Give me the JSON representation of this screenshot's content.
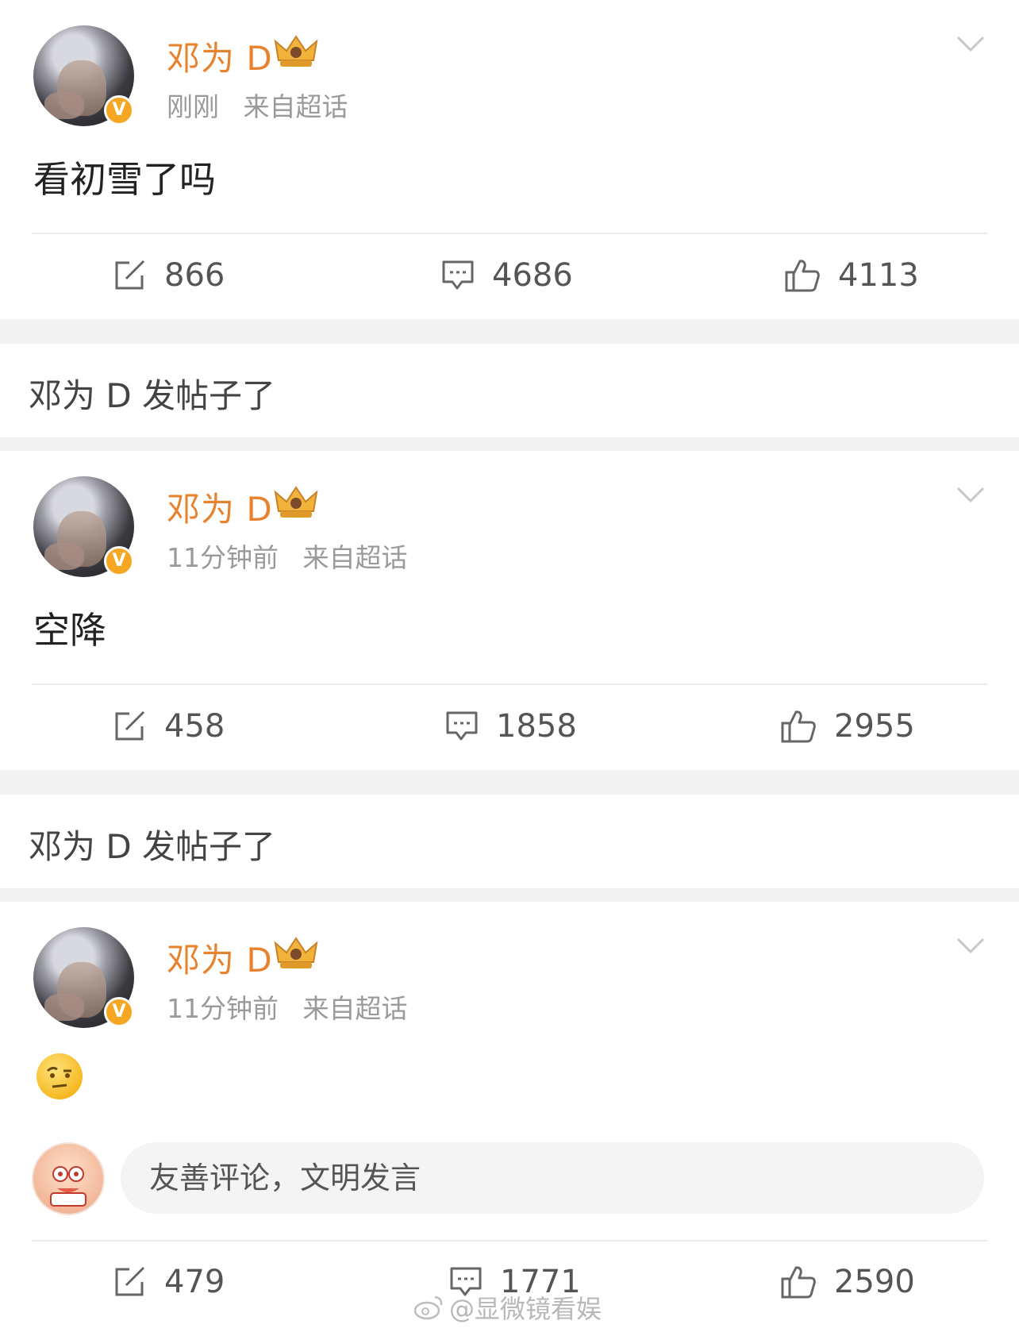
{
  "posts": [
    {
      "username": "邓为 D",
      "time": "刚刚",
      "source": "来自超话",
      "content": "看初雪了吗",
      "reposts": "866",
      "comments": "4686",
      "likes": "4113"
    },
    {
      "username": "邓为 D",
      "time": "11分钟前",
      "source": "来自超话",
      "content": "空降",
      "reposts": "458",
      "comments": "1858",
      "likes": "2955"
    },
    {
      "username": "邓为 D",
      "time": "11分钟前",
      "source": "来自超话",
      "content": "",
      "emoji": "raised-eyebrow-emoji",
      "reposts": "479",
      "comments": "1771",
      "likes": "2590"
    }
  ],
  "section_headers": [
    "邓为 D 发帖子了",
    "邓为 D 发帖子了"
  ],
  "comment_box": {
    "placeholder": "友善评论，文明发言"
  },
  "watermark": "@显微镜看娱",
  "icons": {
    "verified": "verified-v-badge-icon",
    "crown": "crown-badge-icon",
    "more": "chevron-down-icon",
    "repost": "repost-icon",
    "comment": "comment-icon",
    "like": "thumbs-up-icon"
  },
  "colors": {
    "username": "#e8822d",
    "badge": "#f5a623",
    "meta": "#9a9a9a",
    "background": "#f2f2f2"
  }
}
